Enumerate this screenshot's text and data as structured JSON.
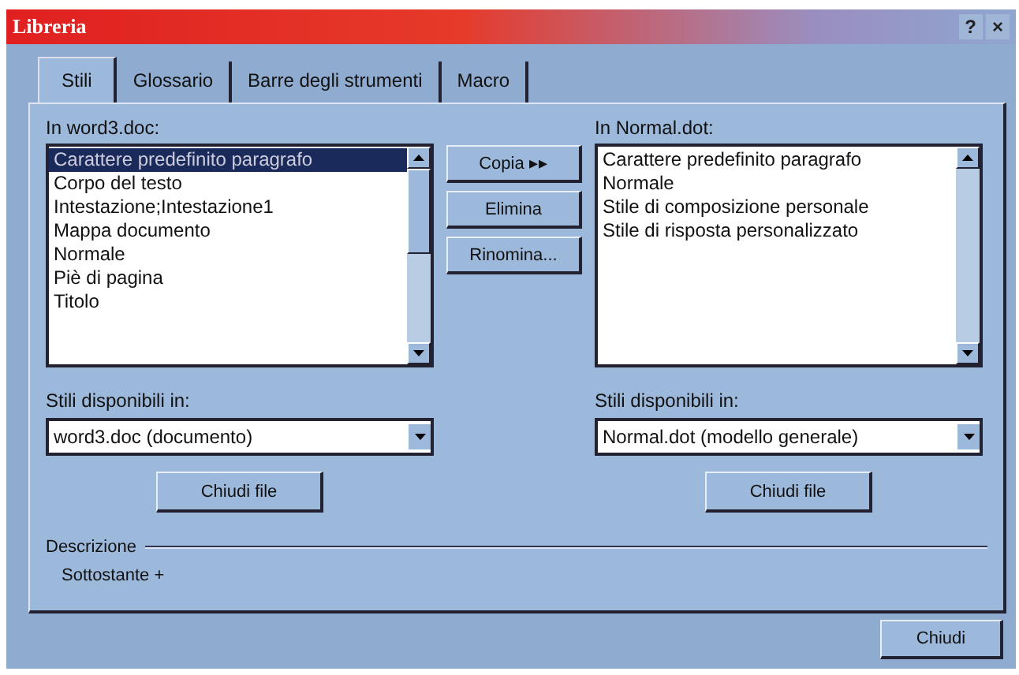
{
  "window": {
    "title": "Libreria",
    "help": "?",
    "close": "×"
  },
  "tabs": [
    {
      "label": "Stili",
      "selected": true
    },
    {
      "label": "Glossario",
      "selected": false
    },
    {
      "label": "Barre degli strumenti",
      "selected": false
    },
    {
      "label": "Macro",
      "selected": false
    }
  ],
  "panes": [
    {
      "label": "In word3.doc:",
      "items": [
        {
          "text": "Carattere predefinito paragrafo",
          "selected": true
        },
        {
          "text": "Corpo del testo",
          "selected": false
        },
        {
          "text": "Intestazione;Intestazione1",
          "selected": false
        },
        {
          "text": "Mappa documento",
          "selected": false
        },
        {
          "text": "Normale",
          "selected": false
        },
        {
          "text": "Piè di pagina",
          "selected": false
        },
        {
          "text": "Titolo",
          "selected": false
        }
      ],
      "available_label": "Stili disponibili in:",
      "available_value": "word3.doc (documento)",
      "close_file": "Chiudi file"
    },
    {
      "label": "In Normal.dot:",
      "items": [
        {
          "text": "Carattere predefinito paragrafo",
          "selected": false
        },
        {
          "text": "Normale",
          "selected": false
        },
        {
          "text": "Stile di composizione personale",
          "selected": false
        },
        {
          "text": "Stile di risposta personalizzato",
          "selected": false
        }
      ],
      "available_label": "Stili disponibili in:",
      "available_value": "Normal.dot (modello generale)",
      "close_file": "Chiudi file"
    }
  ],
  "actions": [
    "Copia ▸▸",
    "Elimina",
    "Rinomina..."
  ],
  "description": {
    "label": "Descrizione",
    "text": "Sottostante +"
  },
  "buttons": [
    "Chiudi"
  ]
}
